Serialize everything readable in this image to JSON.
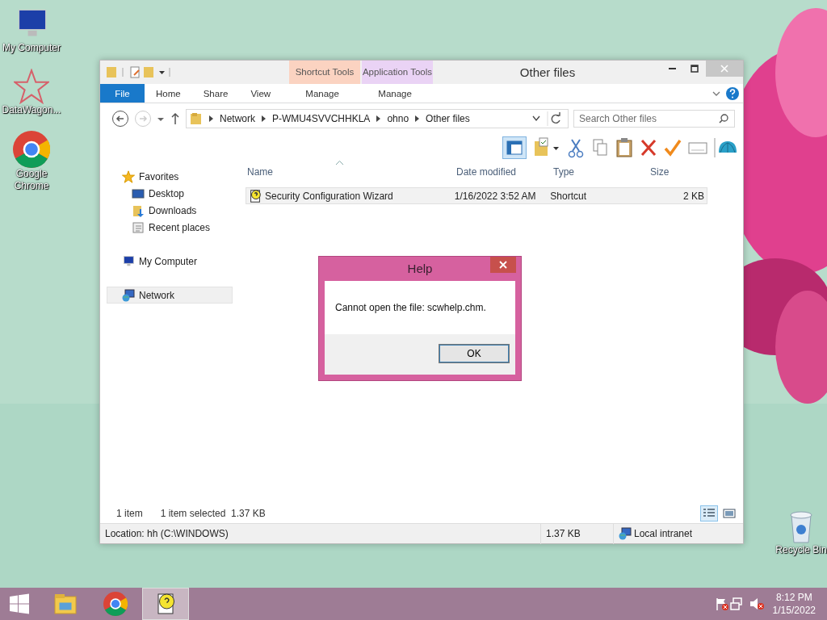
{
  "desktop_icons": [
    {
      "label": "My Computer",
      "kind": "computer"
    },
    {
      "label": "DataWagon...",
      "kind": "star"
    },
    {
      "label": "Google Chrome",
      "kind": "chrome"
    }
  ],
  "recycle_bin": {
    "label": "Recycle Bin"
  },
  "window": {
    "title": "Other files",
    "context_groups": [
      {
        "title": "Shortcut Tools",
        "tab": "Manage",
        "color": "#fbd3c1"
      },
      {
        "title": "Application Tools",
        "tab": "Manage",
        "color": "#ead3f5"
      }
    ],
    "ribbon_tabs": [
      {
        "label": "File",
        "kind": "file"
      },
      {
        "label": "Home",
        "kind": "tab"
      },
      {
        "label": "Share",
        "kind": "tab"
      },
      {
        "label": "View",
        "kind": "tab"
      }
    ],
    "address": [
      "Network",
      "P-WMU4SVVCHHKLA",
      "ohno",
      "Other files"
    ],
    "search": {
      "placeholder": "Search Other files"
    },
    "nav": [
      {
        "label": "Favorites",
        "kind": "star",
        "selected": false,
        "children": [
          {
            "label": "Desktop",
            "kind": "desktop",
            "selected": false
          },
          {
            "label": "Downloads",
            "kind": "downloads",
            "selected": false
          },
          {
            "label": "Recent places",
            "kind": "recent",
            "selected": false
          }
        ]
      },
      {
        "label": "My Computer",
        "kind": "computer",
        "selected": false
      },
      {
        "label": "Network",
        "kind": "network",
        "selected": true
      }
    ],
    "columns": [
      "Name",
      "Date modified",
      "Type",
      "Size"
    ],
    "rows": [
      {
        "name": "Security Configuration Wizard",
        "date": "1/16/2022 3:52 AM",
        "type": "Shortcut",
        "size": "2 KB",
        "selected": true
      }
    ],
    "status": {
      "count": "1 item",
      "selection": "1 item selected",
      "selection_size": "1.37 KB"
    },
    "views": [
      {
        "kind": "details",
        "selected": true
      },
      {
        "kind": "tiles",
        "selected": false
      }
    ],
    "details_bar": {
      "location": "Location: hh (C:\\WINDOWS)",
      "size": "1.37 KB",
      "zone": "Local intranet"
    }
  },
  "dialog": {
    "title": "Help",
    "message": "Cannot open the file: scwhelp.chm.",
    "button": "OK"
  },
  "taskbar": {
    "apps": [
      {
        "kind": "explorer",
        "active": false
      },
      {
        "kind": "chrome",
        "active": false
      },
      {
        "kind": "help",
        "active": true
      }
    ],
    "time": "8:12 PM",
    "date": "1/15/2022"
  }
}
